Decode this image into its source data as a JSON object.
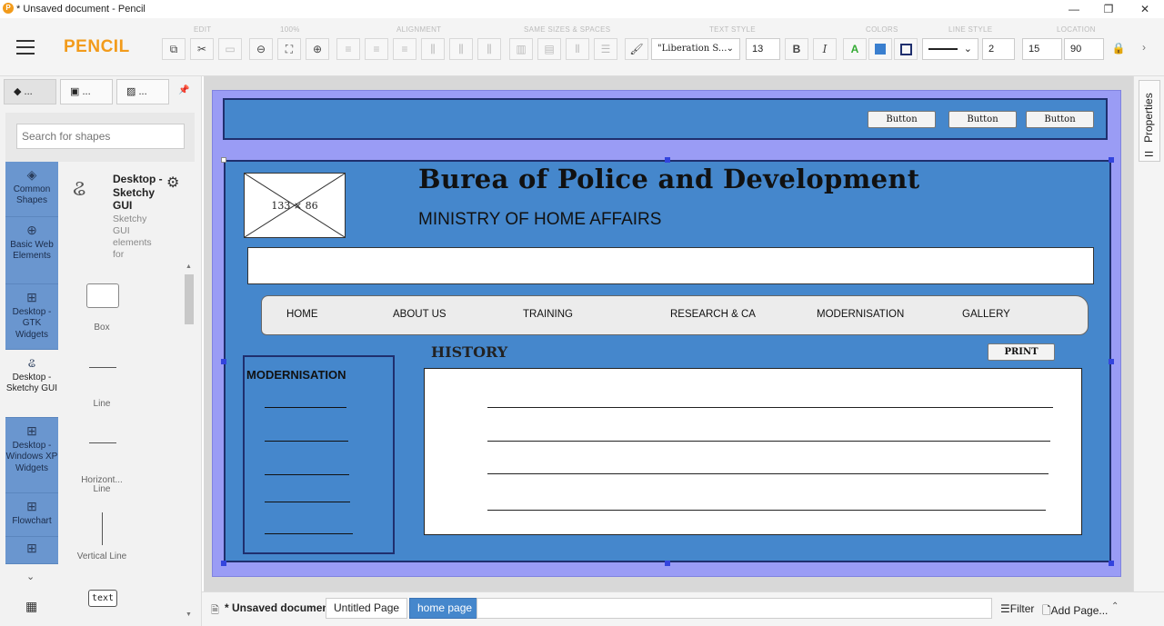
{
  "window": {
    "title": "* Unsaved document - Pencil",
    "logo": "P",
    "min": "—",
    "max": "❐",
    "close": "✕"
  },
  "toolbar": {
    "app_name": "PENCIL",
    "labels": {
      "edit": "EDIT",
      "zoom": "100%",
      "alignment": "ALIGNMENT",
      "sizes": "SAME SIZES & SPACES",
      "text_style": "TEXT STYLE",
      "colors": "COLORS",
      "line_style": "LINE STYLE",
      "location": "LOCATION"
    },
    "font_name": "\"Liberation S...",
    "font_size": "13",
    "bold": "B",
    "italic": "I",
    "text_color_glyph": "A",
    "line_width": "2",
    "loc_x": "15",
    "loc_y": "90",
    "accent_color": "#f29b1b"
  },
  "left_panel": {
    "tabs": [
      "...",
      "...",
      "..."
    ],
    "search_placeholder": "Search for shapes",
    "categories": [
      {
        "label": "Common Shapes",
        "icon": "layers-icon"
      },
      {
        "label": "Basic Web Elements",
        "icon": "globe-icon"
      },
      {
        "label": "Desktop - GTK Widgets",
        "icon": "grid-icon"
      },
      {
        "label": "Desktop - Sketchy GUI",
        "icon": "squiggle-icon"
      },
      {
        "label": "Desktop - Windows XP Widgets",
        "icon": "grid-icon"
      },
      {
        "label": "Flowchart",
        "icon": "grid-icon"
      }
    ],
    "collection": {
      "title": "Desktop - Sketchy GUI",
      "desc": "Sketchy GUI elements for"
    },
    "shapes": [
      "Box",
      "Line",
      "Horizont... Line",
      "Vertical Line",
      "text"
    ]
  },
  "page": {
    "header_buttons": [
      "Button",
      "Button",
      "Button"
    ],
    "image_placeholder": "133 × 86",
    "title": "Burea of Police and Development",
    "subtitle": "MINISTRY OF HOME AFFAIRS",
    "nav": [
      "HOME",
      "ABOUT US",
      "TRAINING",
      "RESEARCH & CA",
      "MODERNISATION",
      "GALLERY"
    ],
    "section_title": "HISTORY",
    "print_label": "PRINT",
    "sidebar_title": "MODERNISATION",
    "colors": {
      "outer": "#9a9cf5",
      "panel": "#4587cc"
    }
  },
  "right_panel": {
    "label": "Properties"
  },
  "bottom_bar": {
    "doc_label": "* Unsaved document",
    "pages": [
      "Untitled Page",
      "home page"
    ],
    "active_page": "home page",
    "filter": "Filter",
    "add_page": "Add Page..."
  }
}
